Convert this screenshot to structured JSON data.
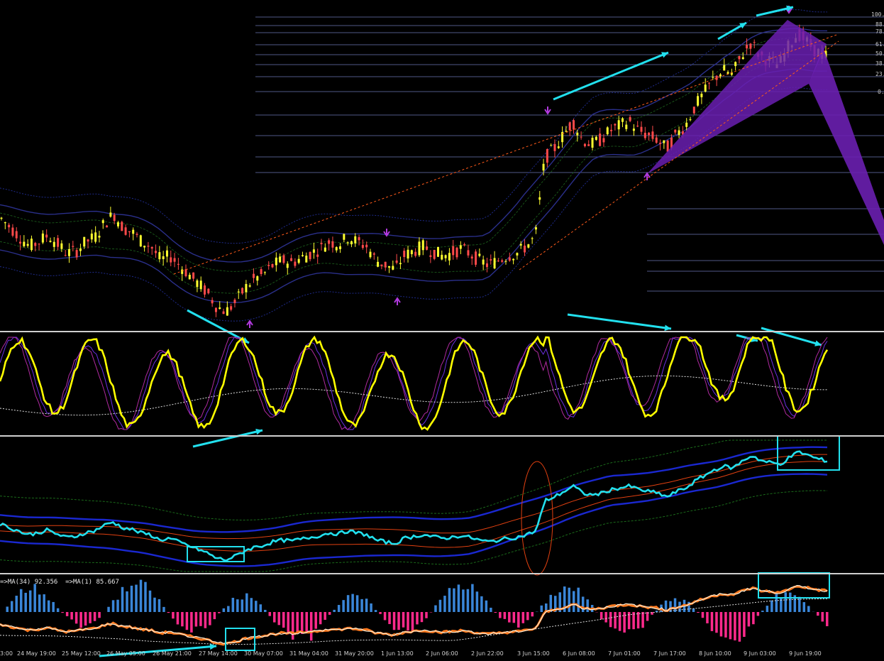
{
  "chart_data": {
    "type": "candlestick-multi-panel",
    "fibonacci_levels": [
      "100.",
      "88.",
      "78.",
      "61.",
      "50.",
      "38.",
      "23.",
      "0."
    ],
    "indicator_label": "=>MA(34) 92.356  =>MA(1) 85.667",
    "x_ticks": [
      "3:00",
      "24 May 19:00",
      "25 May 12:00",
      "26 May 05:00",
      "26 May 21:00",
      "27 May 14:00",
      "30 May 07:00",
      "31 May 04:00",
      "31 May 20:00",
      "1 Jun 13:00",
      "2 Jun 06:00",
      "2 Jun 22:00",
      "3 Jun 15:00",
      "6 Jun 08:00",
      "7 Jun 01:00",
      "7 Jun 17:00",
      "8 Jun 10:00",
      "9 Jun 03:00",
      "9 Jun 19:00"
    ],
    "price_series": [
      70,
      66,
      62,
      58,
      60,
      63,
      59,
      55,
      56,
      60,
      62,
      68,
      72,
      66,
      64,
      60,
      58,
      52,
      54,
      50,
      46,
      42,
      38,
      32,
      30,
      34,
      40,
      44,
      46,
      50,
      52,
      51,
      53,
      55,
      57,
      60,
      59,
      62,
      60,
      58,
      52,
      50,
      48,
      54,
      56,
      58,
      56,
      54,
      55,
      57,
      55,
      52,
      50,
      52,
      54,
      55,
      58,
      62,
      96,
      100,
      106,
      112,
      104,
      102,
      104,
      108,
      110,
      112,
      108,
      106,
      104,
      100,
      106,
      110,
      118,
      124,
      130,
      134,
      132,
      140,
      146,
      140,
      138,
      136,
      144,
      150,
      146,
      142,
      140
    ],
    "colors": {
      "bull": "#ffff30",
      "bear": "#ff4a4a",
      "arrow": "#22e0ee",
      "fibo": "#9aa8ff",
      "pattern": "#6a1fb0",
      "oscillator": "#ffff00",
      "price_line": "#22e0ee",
      "hist_up": "#3a86d8",
      "hist_down": "#ff2a8c"
    }
  }
}
